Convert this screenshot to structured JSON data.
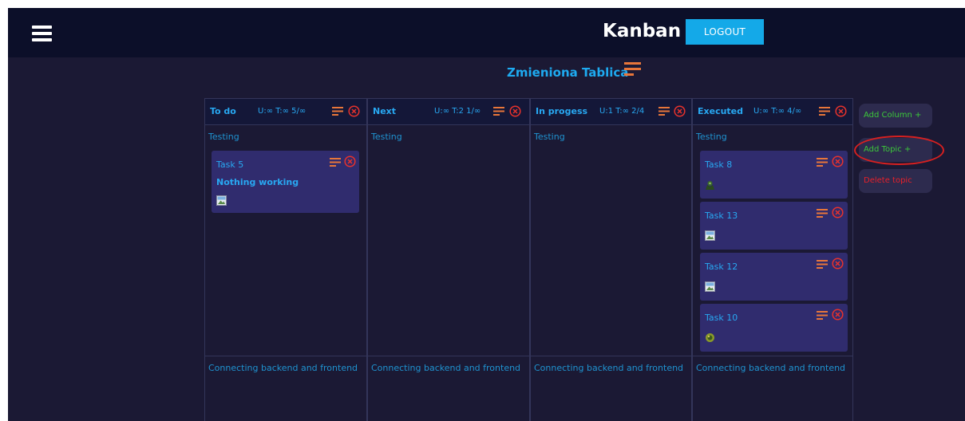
{
  "app": {
    "title": "Kanban",
    "logout_label": "LOGOUT"
  },
  "board": {
    "title": "Zmieniona Tablica"
  },
  "columns": [
    {
      "name": "To do",
      "limits": "U:∞  T:∞  5/∞"
    },
    {
      "name": "Next",
      "limits": "U:∞  T:2  1/∞"
    },
    {
      "name": "In progess",
      "limits": "U:1  T:∞  2/4"
    },
    {
      "name": "Executed",
      "limits": "U:∞  T:∞  4/∞"
    }
  ],
  "topics": [
    "Testing",
    "Connecting backend and frontend"
  ],
  "cards": {
    "todo": [
      {
        "title": "Task 5",
        "description": "Nothing working"
      }
    ],
    "executed": [
      {
        "title": "Task 8"
      },
      {
        "title": "Task 13"
      },
      {
        "title": "Task 12"
      },
      {
        "title": "Task 10"
      }
    ]
  },
  "sidebar": {
    "add_column_label": "Add Column +",
    "add_topic_label": "Add Topic +",
    "delete_topic_label": "Delete topic"
  },
  "colors": {
    "accent": "#14a9e8",
    "menu_icon": "#e8763a",
    "close_icon": "#e8322c",
    "add_text": "#3cc83a",
    "delete_text": "#e8202a",
    "highlight": "#d72020"
  },
  "icons": [
    "hamburger-icon",
    "lines-menu-icon",
    "close-circle-icon",
    "image-placeholder-icon",
    "avatar-icon"
  ]
}
